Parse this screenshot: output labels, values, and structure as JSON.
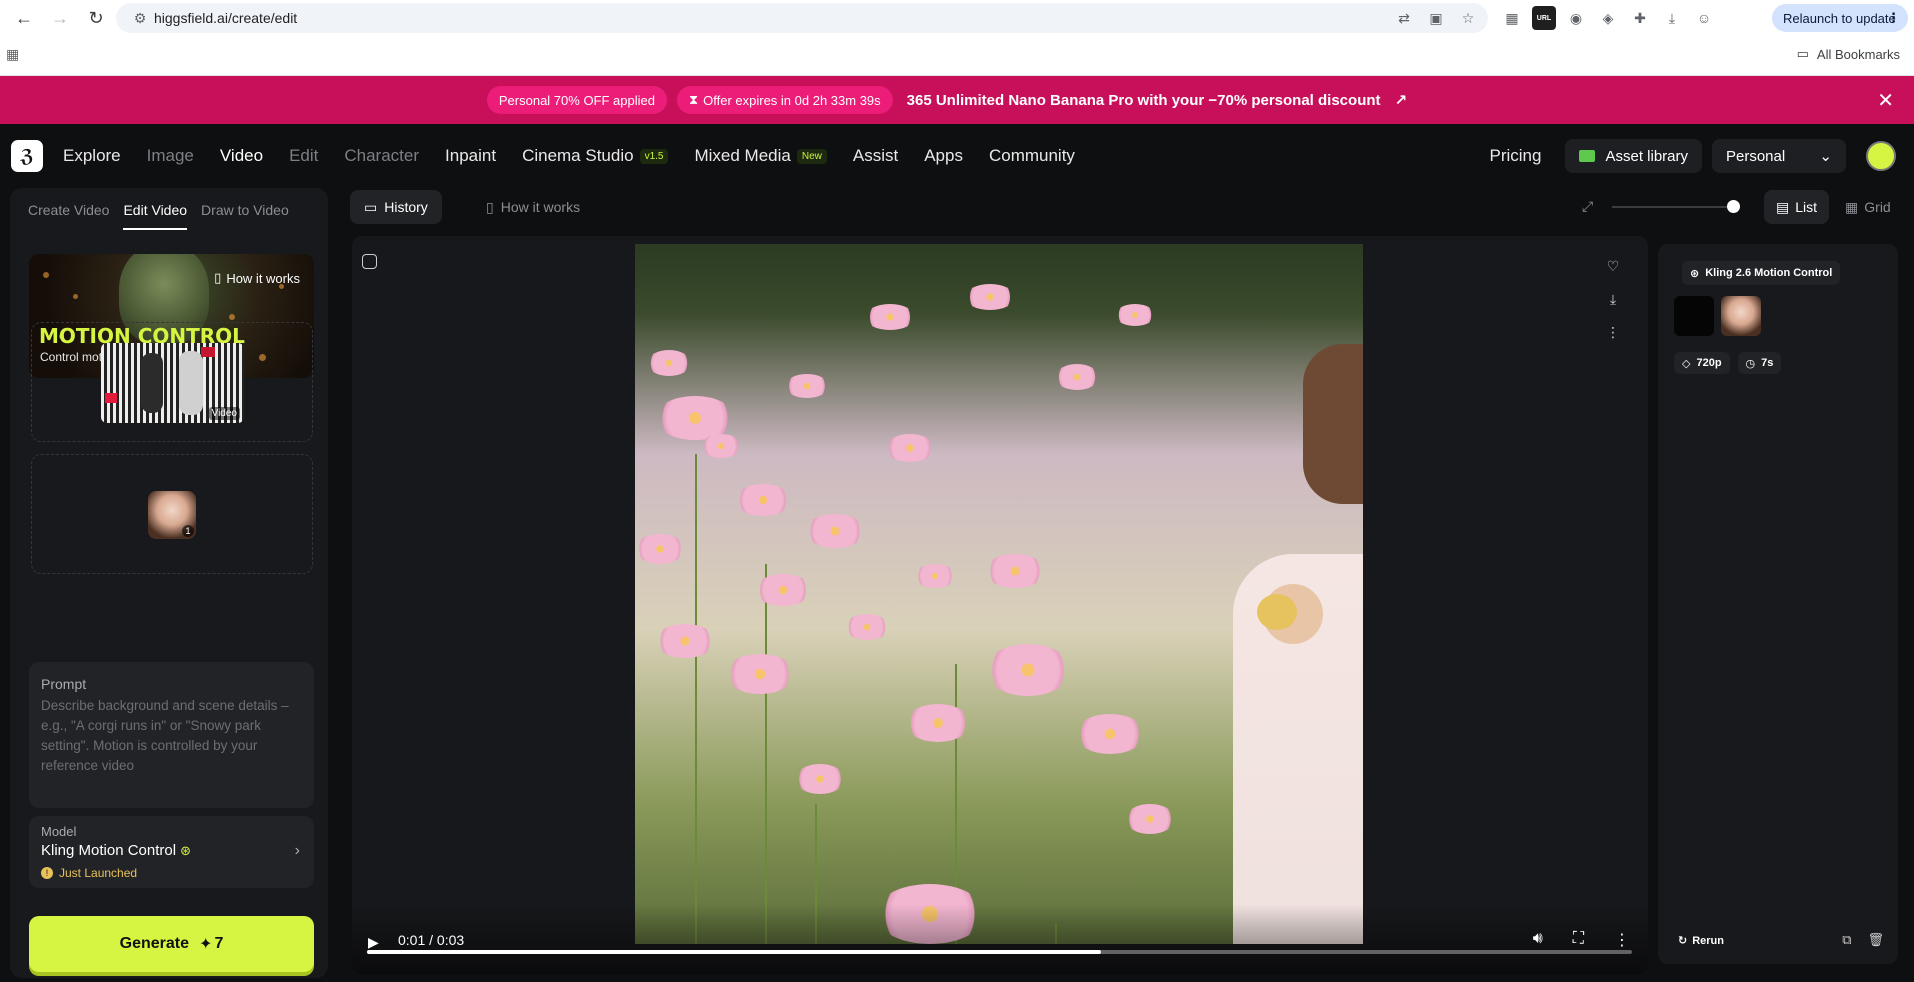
{
  "browser": {
    "url": "higgsfield.ai/create/edit",
    "relaunch_label": "Relaunch to update",
    "bookmarks_label": "All Bookmarks",
    "ext_url_label": "URL"
  },
  "promo": {
    "pill1": "Personal 70% OFF applied",
    "pill2": "Offer expires in 0d 2h 33m 39s",
    "text": "365 Unlimited Nano Banana Pro with your −70% personal discount"
  },
  "nav": {
    "items": [
      {
        "label": "Explore"
      },
      {
        "label": "Image"
      },
      {
        "label": "Video"
      },
      {
        "label": "Edit"
      },
      {
        "label": "Character"
      },
      {
        "label": "Inpaint"
      },
      {
        "label": "Cinema Studio",
        "badge": "v1.5"
      },
      {
        "label": "Mixed Media",
        "badge": "New"
      },
      {
        "label": "Assist"
      },
      {
        "label": "Apps"
      },
      {
        "label": "Community"
      }
    ],
    "pricing": "Pricing",
    "asset_library": "Asset library",
    "workspace": "Personal"
  },
  "left": {
    "tabs": [
      "Create Video",
      "Edit Video",
      "Draw to Video"
    ],
    "hero": {
      "how_it_works": "How it works",
      "title": "MOTION CONTROL",
      "subtitle": "Control motion with video references"
    },
    "video_label": "Video",
    "image_count": "1",
    "prompt": {
      "label": "Prompt",
      "placeholder": "Describe background and scene details – e.g., \"A corgi runs in\" or \"Snowy park setting\". Motion is controlled by your reference video"
    },
    "model": {
      "label": "Model",
      "name": "Kling Motion Control",
      "status": "Just Launched"
    },
    "generate": {
      "label": "Generate",
      "cost": "7"
    }
  },
  "center": {
    "tabs": [
      "History",
      "How it works"
    ],
    "views": [
      "List",
      "Grid"
    ],
    "zoom_level": 0.9,
    "video": {
      "time": "0:01 / 0:03",
      "progress": 0.58
    }
  },
  "meta": {
    "model": "Kling 2.6 Motion Control",
    "resolution": "720p",
    "duration": "7s",
    "rerun": "Rerun"
  },
  "colors": {
    "accent": "#d6f542",
    "promo_bg": "#c8105a",
    "promo_pill": "#ec1d79",
    "panel_bg": "#18191c"
  }
}
